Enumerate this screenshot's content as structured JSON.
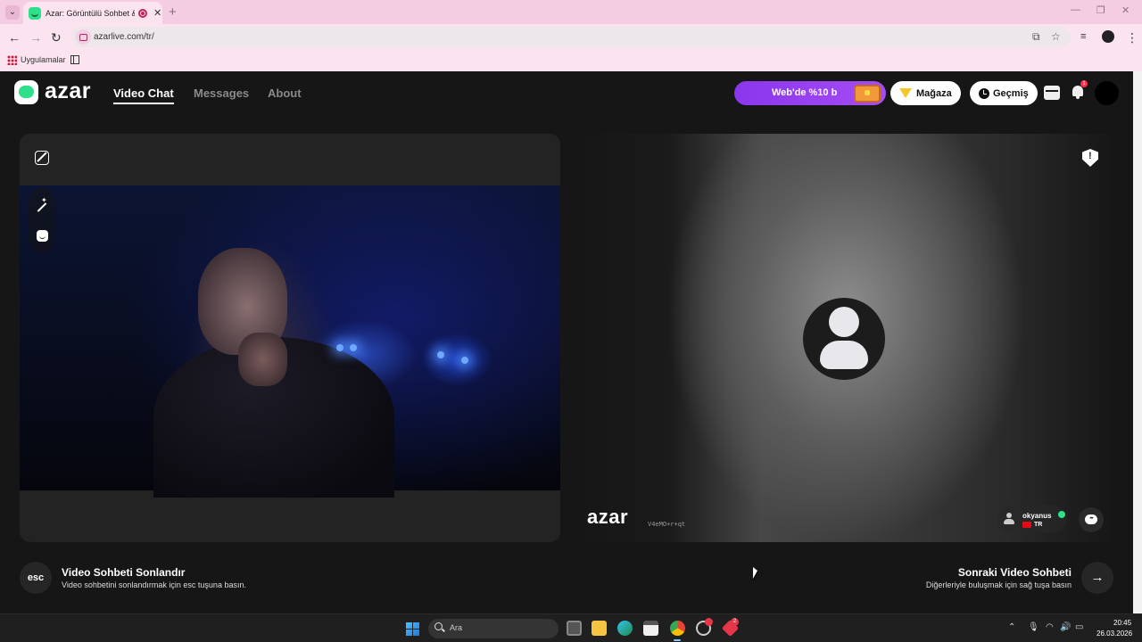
{
  "browser": {
    "tab_title": "Azar: Görüntülü Sohbet & V",
    "url": "azarlive.com/tr/",
    "bookmarks_label": "Uygulamalar"
  },
  "header": {
    "logo": "azar",
    "nav": [
      {
        "label": "Video Chat",
        "active": true
      },
      {
        "label": "Messages",
        "active": false
      },
      {
        "label": "About",
        "active": false
      }
    ],
    "promo_label": "Web'de %10 b",
    "store_label": "Mağaza",
    "history_label": "Geçmiş",
    "notification_count": "1"
  },
  "peer": {
    "watermark": "azar",
    "watermark_code": "V4eMO+r+qt",
    "username": "okyanus",
    "country": "TR"
  },
  "controls": {
    "end_key": "esc",
    "end_title": "Video Sohbeti Sonlandır",
    "end_subtitle": "Video sohbetini sonlandırmak için esc tuşuna basın.",
    "next_title": "Sonraki Video Sohbeti",
    "next_subtitle": "Diğerleriyle buluşmak için sağ tuşa basın"
  },
  "taskbar": {
    "search_placeholder": "Ara",
    "chrome_badge": "2",
    "time": "20:45",
    "date": "26.03.2026"
  },
  "colors": {
    "brand_green": "#2ee089",
    "promo_purple": "#8a36ec",
    "page_bg": "#161616"
  }
}
